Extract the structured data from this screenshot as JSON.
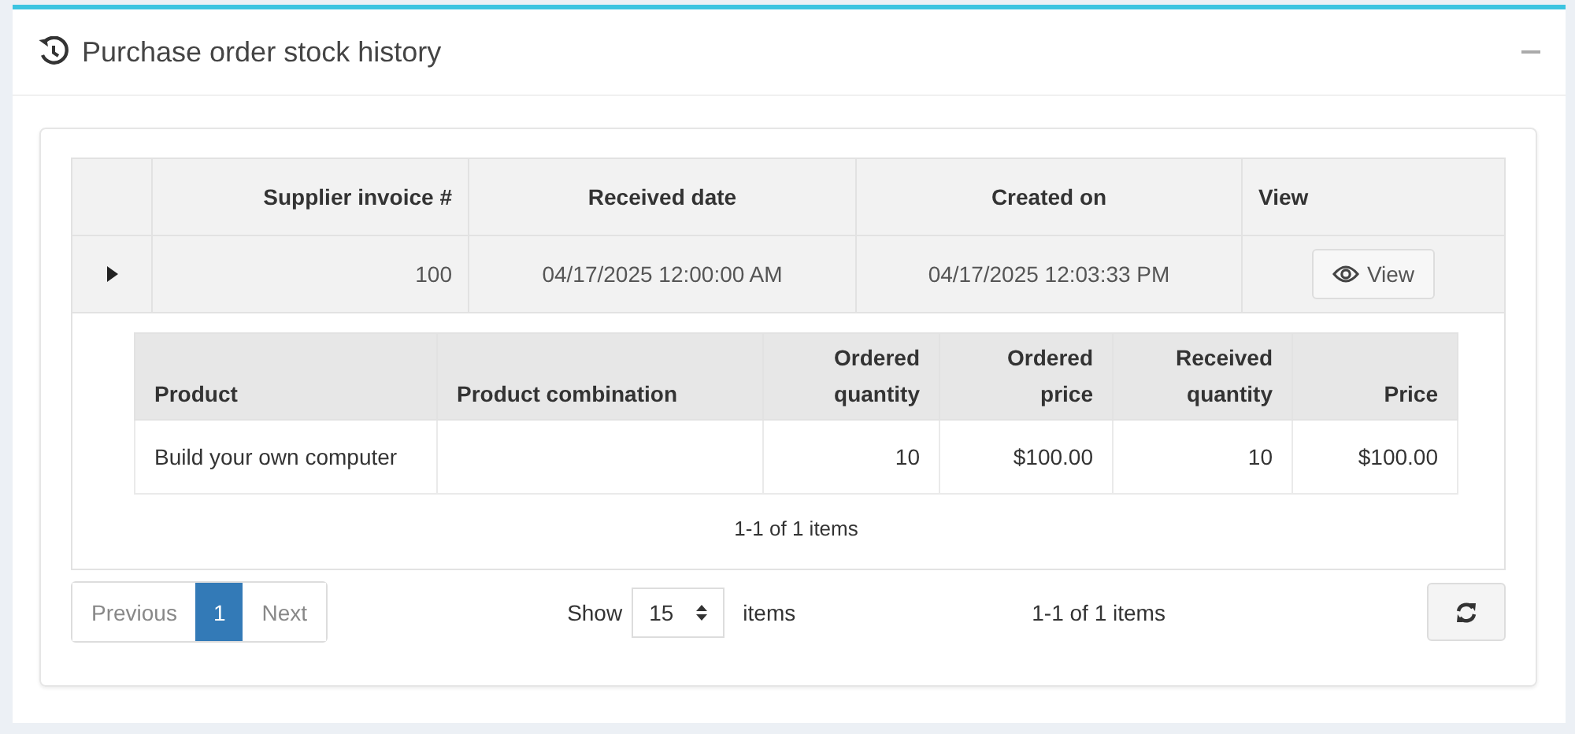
{
  "panel": {
    "title": "Purchase order stock history"
  },
  "table": {
    "columns": [
      "Supplier invoice #",
      "Received date",
      "Created on",
      "View"
    ],
    "rows": [
      {
        "expanded": true,
        "invoice": "100",
        "received_date": "04/17/2025 12:00:00 AM",
        "created_on": "04/17/2025 12:03:33 PM",
        "view_button": "View",
        "detail": {
          "columns": [
            "Product",
            "Product combination",
            "Ordered quantity",
            "Ordered price",
            "Received quantity",
            "Price"
          ],
          "rows": [
            [
              "Build your own computer",
              "",
              "10",
              "$100.00",
              "10",
              "$100.00"
            ]
          ],
          "summary": "1-1 of 1 items"
        }
      }
    ]
  },
  "pager": {
    "previous": "Previous",
    "pages": [
      {
        "label": "1",
        "selected": true
      }
    ],
    "next": "Next",
    "show_label": "Show",
    "page_size": "15",
    "items_label": "items",
    "summary": "1-1 of 1 items"
  }
}
